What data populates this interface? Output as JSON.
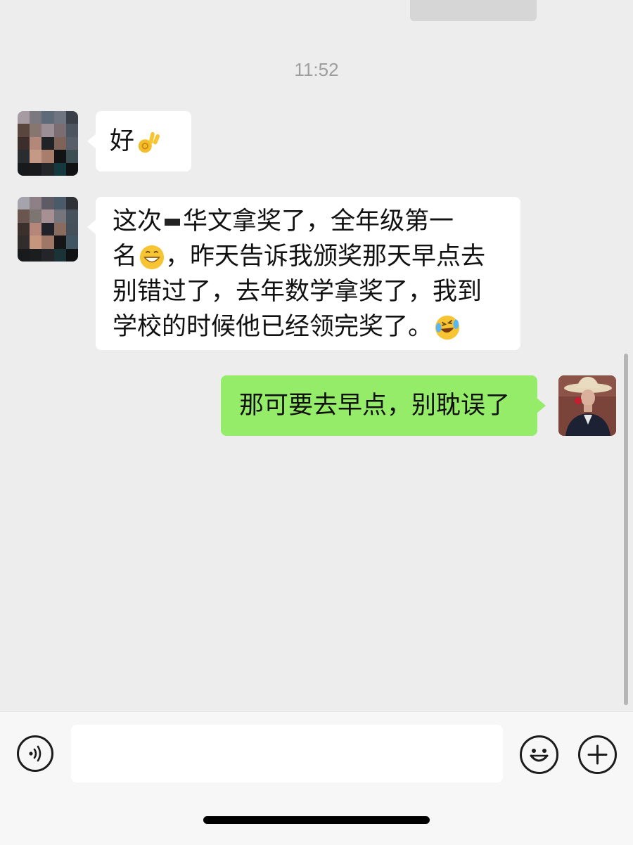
{
  "timestamp": "11:52",
  "messages": [
    {
      "sender": "contact",
      "text": "好",
      "emoji": "ok-hand-emoji"
    },
    {
      "sender": "contact",
      "lines": [
        {
          "before": "这次",
          "after": "华文拿奖了，全年级第一"
        },
        {
          "text": "名",
          "emoji": "grinning-emoji",
          "after": "，昨天告诉我颁奖那天早点去"
        },
        {
          "text": "别错过了，去年数学拿奖了，我到"
        },
        {
          "text": "学校的时候他已经领完奖了。",
          "emoji": "laughing-crying-emoji"
        }
      ]
    },
    {
      "sender": "me",
      "text": "那可要去早点，别耽误了"
    }
  ],
  "input_bar": {
    "placeholder": "",
    "voice_icon": "voice-icon",
    "emoji_icon": "smiley-icon",
    "more_icon": "plus-icon"
  },
  "colors": {
    "background": "#ededed",
    "my_bubble": "#95ec69",
    "their_bubble": "#ffffff",
    "timestamp": "#9e9e9e"
  }
}
